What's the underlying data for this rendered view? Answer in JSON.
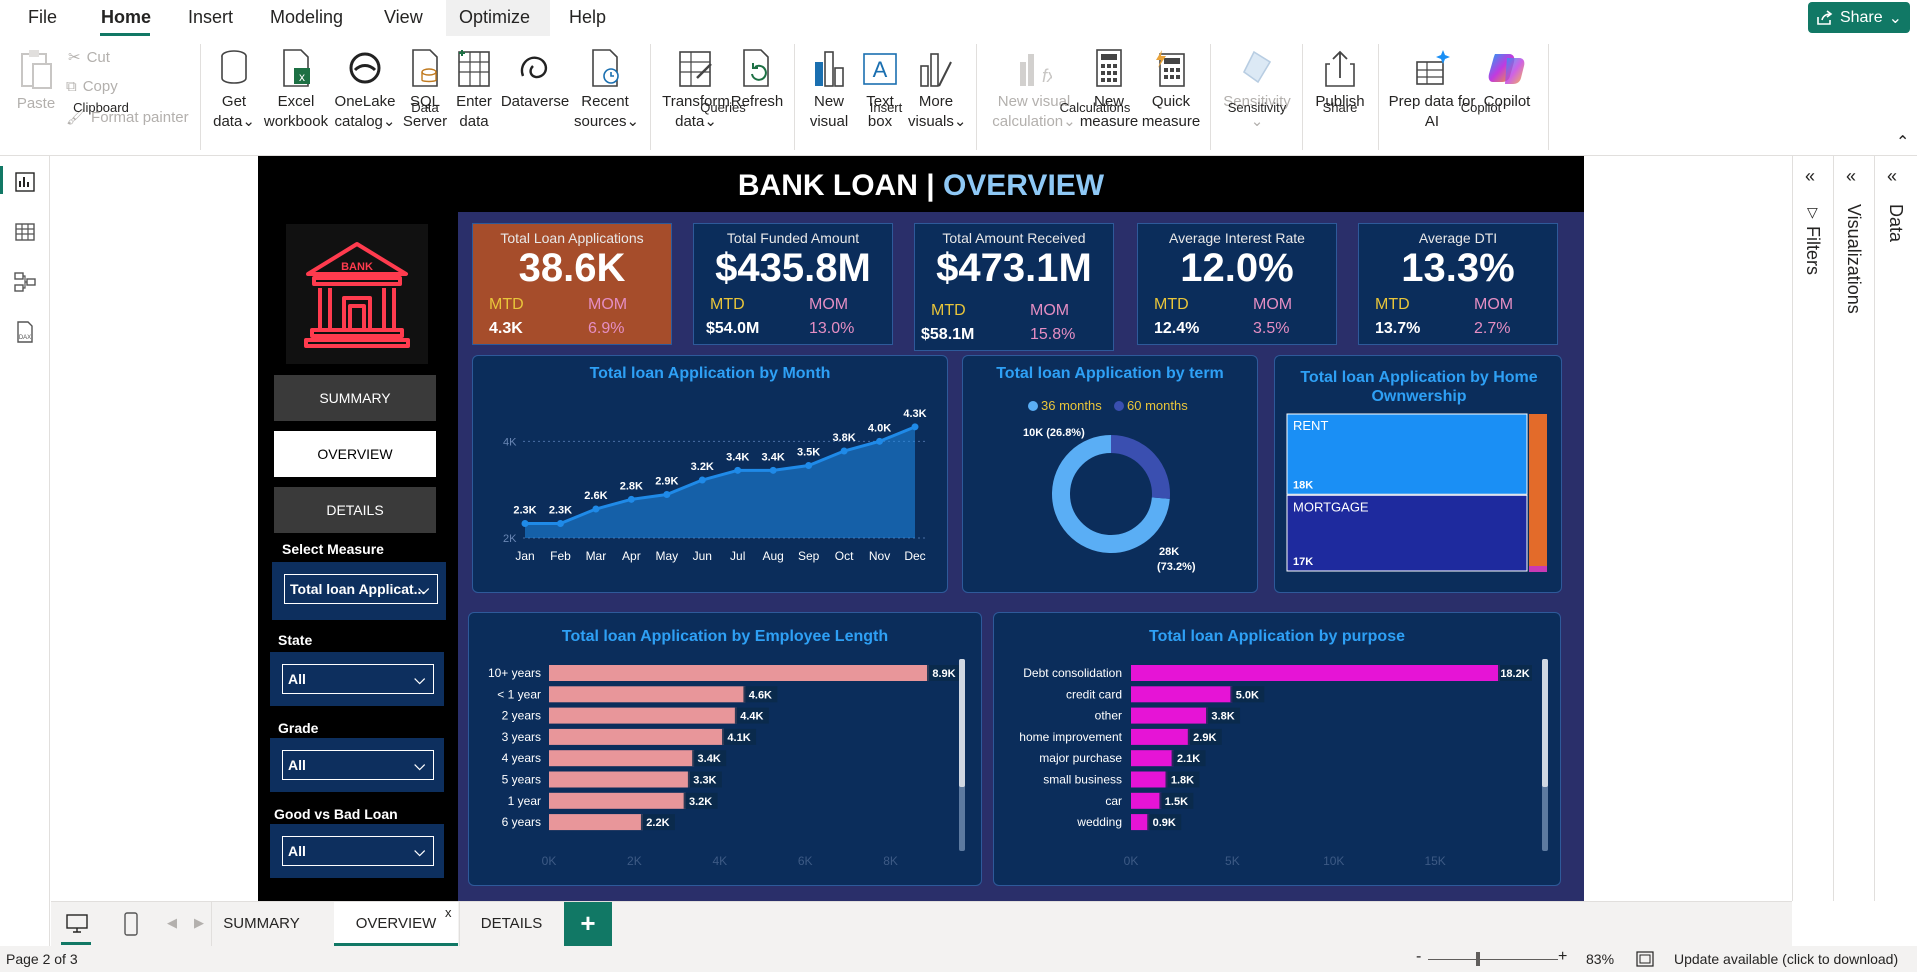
{
  "menu": {
    "file": "File",
    "home": "Home",
    "insert": "Insert",
    "modeling": "Modeling",
    "view": "View",
    "optimize": "Optimize",
    "help": "Help",
    "share": "Share"
  },
  "ribbon": {
    "paste": "Paste",
    "cut": "Cut",
    "copy": "Copy",
    "format_painter": "Format painter",
    "get_data": [
      "Get",
      "data"
    ],
    "excel": [
      "Excel",
      "workbook"
    ],
    "onelake": [
      "OneLake",
      "catalog"
    ],
    "sql": [
      "SQL",
      "Server"
    ],
    "enter": [
      "Enter",
      "data"
    ],
    "dataverse": "Dataverse",
    "recent": [
      "Recent",
      "sources"
    ],
    "transform": [
      "Transform",
      "data"
    ],
    "refresh": "Refresh",
    "new_visual": [
      "New",
      "visual"
    ],
    "text_box": [
      "Text",
      "box"
    ],
    "more_visuals": [
      "More",
      "visuals"
    ],
    "new_visual_calc": [
      "New visual",
      "calculation"
    ],
    "new_measure": [
      "New",
      "measure"
    ],
    "quick_measure": [
      "Quick",
      "measure"
    ],
    "sensitivity": "Sensitivity",
    "publish": "Publish",
    "prep_data": [
      "Prep data for",
      "AI"
    ],
    "copilot": "Copilot",
    "groups": {
      "clipboard": "Clipboard",
      "data": "Data",
      "queries": "Queries",
      "insert": "Insert",
      "calculations": "Calculations",
      "sensitivity": "Sensitivity",
      "share": "Share",
      "copilot": "Copilot"
    }
  },
  "report": {
    "title_main": "BANK LOAN | ",
    "title_sub": "OVERVIEW",
    "logo_text": "BANK",
    "nav": {
      "summary": "SUMMARY",
      "overview": "OVERVIEW",
      "details": "DETAILS"
    },
    "slicers": [
      {
        "label": "Select Measure",
        "value": "Total loan Applicat..."
      },
      {
        "label": "State",
        "value": "All"
      },
      {
        "label": "Grade",
        "value": "All"
      },
      {
        "label": "Good vs Bad Loan",
        "value": "All"
      }
    ],
    "kpis": [
      {
        "title": "Total Loan Applications",
        "value": "38.6K",
        "mtd_label": "MTD",
        "mtd": "4.3K",
        "mom_label": "MOM",
        "mom": "6.9%"
      },
      {
        "title": "Total Funded Amount",
        "value": "$435.8M",
        "mtd_label": "MTD",
        "mtd": "$54.0M",
        "mom_label": "MOM",
        "mom": "13.0%"
      },
      {
        "title": "Total Amount Received",
        "value": "$473.1M",
        "mtd_label": "MTD",
        "mtd": "$58.1M",
        "mom_label": "MOM",
        "mom": "15.8%"
      },
      {
        "title": "Average Interest Rate",
        "value": "12.0%",
        "mtd_label": "MTD",
        "mtd": "12.4%",
        "mom_label": "MOM",
        "mom": "3.5%"
      },
      {
        "title": "Average DTI",
        "value": "13.3%",
        "mtd_label": "MTD",
        "mtd": "13.7%",
        "mom_label": "MOM",
        "mom": "2.7%"
      }
    ],
    "highlight_color": "#a64d2b"
  },
  "chart_data": [
    {
      "type": "area",
      "title": "Total loan Application by Month",
      "categories": [
        "Jan",
        "Feb",
        "Mar",
        "Apr",
        "May",
        "Jun",
        "Jul",
        "Aug",
        "Sep",
        "Oct",
        "Nov",
        "Dec"
      ],
      "values": [
        2.3,
        2.3,
        2.6,
        2.8,
        2.9,
        3.2,
        3.4,
        3.4,
        3.5,
        3.8,
        4.0,
        4.3
      ],
      "labels": [
        "2.3K",
        "2.3K",
        "2.6K",
        "2.8K",
        "2.9K",
        "3.2K",
        "3.4K",
        "3.4K",
        "3.5K",
        "3.8K",
        "4.0K",
        "4.3K"
      ],
      "yticks": [
        "2K",
        "4K"
      ],
      "ylim": [
        2.0,
        4.4
      ],
      "color": "#1f8ae8"
    },
    {
      "type": "pie",
      "title": "Total loan Application by term",
      "legend": [
        "36 months",
        "60 months"
      ],
      "values": [
        28,
        10
      ],
      "labels": [
        "28K",
        "(73.2%)",
        "10K (26.8%)"
      ],
      "colors": [
        "#5aaef5",
        "#3a4fb0"
      ],
      "legend_colors": [
        "#e9c53a",
        "#e9c53a"
      ]
    },
    {
      "type": "treemap",
      "title": "Total loan Application by Home Ownwership",
      "items": [
        {
          "name": "RENT",
          "value": 18,
          "label": "18K",
          "color": "#1a8ff5"
        },
        {
          "name": "MORTGAGE",
          "value": 17,
          "label": "17K",
          "color": "#1e2a9e"
        }
      ],
      "side_colors": [
        "#e36b2a",
        "#c93ab5"
      ]
    },
    {
      "type": "bar",
      "title": "Total loan Application by Employee Length",
      "categories": [
        "10+ years",
        "< 1 year",
        "2 years",
        "3 years",
        "4 years",
        "5 years",
        "1 year",
        "6 years"
      ],
      "values": [
        8.9,
        4.6,
        4.4,
        4.1,
        3.4,
        3.3,
        3.2,
        2.2
      ],
      "labels": [
        "8.9K",
        "4.6K",
        "4.4K",
        "4.1K",
        "3.4K",
        "3.3K",
        "3.2K",
        "2.2K"
      ],
      "xticks": [
        "0K",
        "2K",
        "4K",
        "6K",
        "8K"
      ],
      "xlim": [
        0,
        8.9
      ],
      "color": "#e8969a"
    },
    {
      "type": "bar",
      "title": "Total loan Application by purpose",
      "categories": [
        "Debt consolidation",
        "credit card",
        "other",
        "home improvement",
        "major purchase",
        "small business",
        "car",
        "wedding"
      ],
      "values": [
        18.2,
        5.0,
        3.8,
        2.9,
        2.1,
        1.8,
        1.5,
        0.9
      ],
      "labels": [
        "18.2K",
        "5.0K",
        "3.8K",
        "2.9K",
        "2.1K",
        "1.8K",
        "1.5K",
        "0.9K"
      ],
      "xticks": [
        "0K",
        "5K",
        "10K",
        "15K"
      ],
      "xlim": [
        0,
        18.2
      ],
      "color": "#e614d6"
    }
  ],
  "right_panes": {
    "filters": "Filters",
    "visualizations": "Visualizations",
    "data": "Data"
  },
  "pages": {
    "tabs": [
      "SUMMARY",
      "OVERVIEW",
      "DETAILS"
    ],
    "add": "+",
    "close": "x"
  },
  "status": {
    "page": "Page 2 of 3",
    "minus": "-",
    "plus": "+",
    "zoom": "83%",
    "update": "Update available (click to download)"
  }
}
